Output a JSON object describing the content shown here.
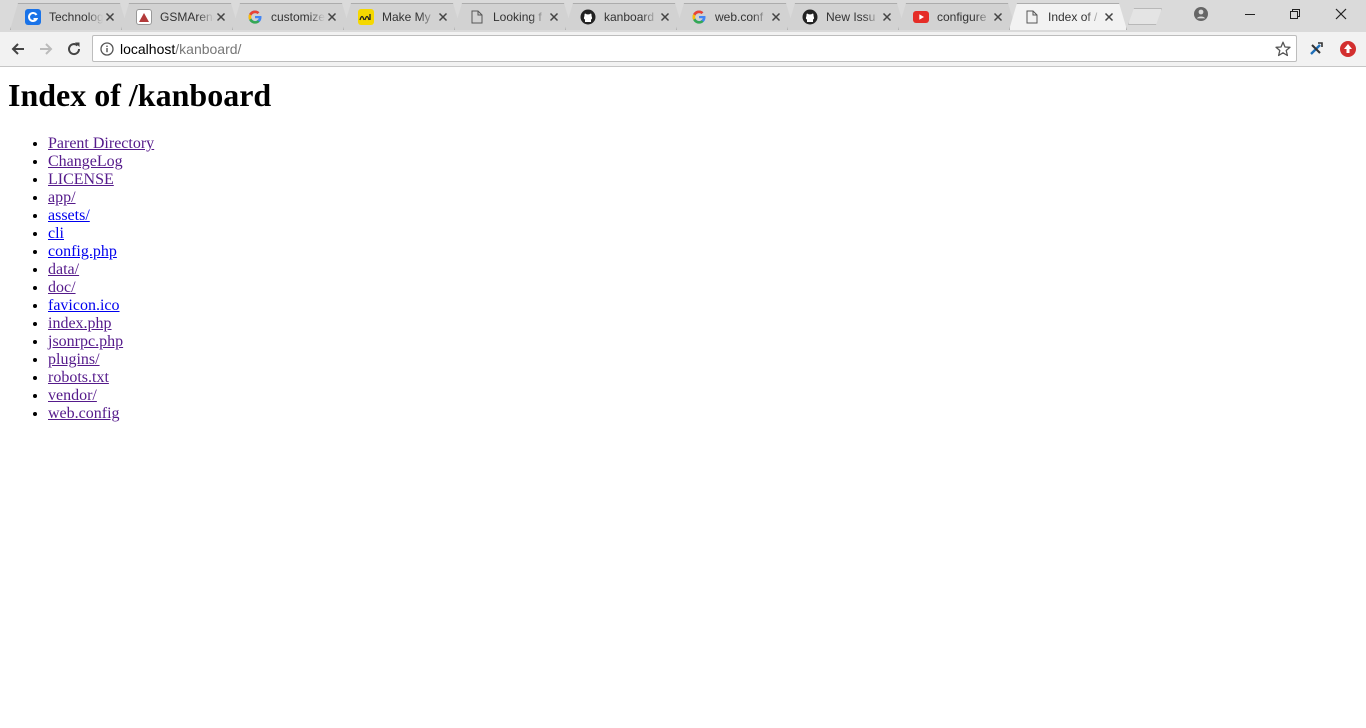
{
  "tabs": [
    {
      "title": "Technology",
      "icon": "technology-g-icon",
      "color": "#1a73e8"
    },
    {
      "title": "GSMArena",
      "icon": "gsmarena-icon",
      "color": "#b33a3a"
    },
    {
      "title": "customize",
      "icon": "google-icon",
      "color": "#4285f4"
    },
    {
      "title": "Make My",
      "icon": "dof-icon",
      "color": "#f5d800"
    },
    {
      "title": "Looking f",
      "icon": "page-icon",
      "color": "#555555"
    },
    {
      "title": "kanboard",
      "icon": "github-icon",
      "color": "#222222"
    },
    {
      "title": "web.conf",
      "icon": "google-icon",
      "color": "#4285f4"
    },
    {
      "title": "New Issu",
      "icon": "github-icon",
      "color": "#222222"
    },
    {
      "title": "configure",
      "icon": "youtube-icon",
      "color": "#e52d27"
    },
    {
      "title": "Index of /",
      "icon": "page-icon",
      "color": "#555555",
      "active": true
    }
  ],
  "address": {
    "host": "localhost",
    "path": "/kanboard/"
  },
  "page": {
    "title": "Index of /kanboard",
    "entries": [
      {
        "label": "Parent Directory",
        "visited": true
      },
      {
        "label": "ChangeLog",
        "visited": true
      },
      {
        "label": "LICENSE",
        "visited": true
      },
      {
        "label": "app/",
        "visited": true
      },
      {
        "label": "assets/",
        "visited": false
      },
      {
        "label": "cli",
        "visited": false
      },
      {
        "label": "config.php",
        "visited": false
      },
      {
        "label": "data/",
        "visited": true
      },
      {
        "label": "doc/",
        "visited": true
      },
      {
        "label": "favicon.ico",
        "visited": false
      },
      {
        "label": "index.php",
        "visited": true
      },
      {
        "label": "jsonrpc.php",
        "visited": true
      },
      {
        "label": "plugins/",
        "visited": true
      },
      {
        "label": "robots.txt",
        "visited": true
      },
      {
        "label": "vendor/",
        "visited": true
      },
      {
        "label": "web.config",
        "visited": true
      }
    ]
  }
}
